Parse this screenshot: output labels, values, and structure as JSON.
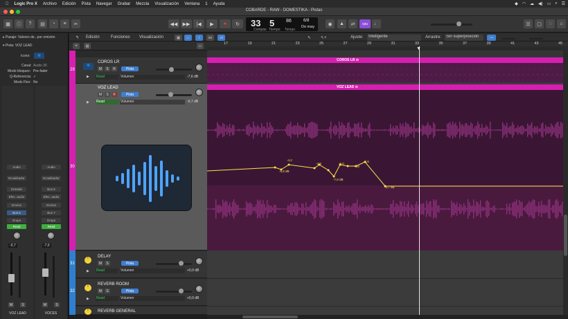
{
  "menubar": {
    "app": "Logic Pro X",
    "items": [
      "Archivo",
      "Edición",
      "Pista",
      "Navegar",
      "Grabar",
      "Mezcla",
      "Visualización",
      "Ventana",
      "1",
      "Ayuda"
    ]
  },
  "window": {
    "title": "COBARDE - RAW - DOMESTIKA - Pistas"
  },
  "lcd": {
    "bar": "33",
    "beat": "5",
    "bar_label": "Compás",
    "beat_label": "Tiempo",
    "tempo": "86",
    "tempo_label": "Tempo",
    "signature": "6/8",
    "key": "Do may",
    "badge": "cpu"
  },
  "toolbar": {
    "edicion": "Edición",
    "funciones": "Funciones",
    "visualizacion": "Visualización",
    "ajuste_label": "Ajuste:",
    "ajuste_value": "Inteligente",
    "arrastre_label": "Arrastre:",
    "arrastre_value": "Sin superposición"
  },
  "inspector": {
    "region_label": "Pasaje:",
    "region_value": "Valores de...por omisión",
    "track_label": "Pista:",
    "track_value": "VOZ LEAD",
    "icono_label": "Icono:",
    "canal_label": "Canal:",
    "canal_value": "Audio 36",
    "modo_bloqueo_label": "Modo bloqueo:",
    "modo_bloqueo_value": "Pre-fader",
    "qref_label": "Q-Referencia:",
    "qref_value": "✓",
    "modo_flex_label": "Modo Flex:",
    "modo_flex_value": "No",
    "strip_left": {
      "audio": "Audio",
      "ecualizador": "Ecualizador",
      "entrada": "Entrada",
      "efec_audio": "Efec. audio",
      "envios": "Envíos",
      "send1": "Bus 5",
      "grupo": "Grupo",
      "automation": "Read",
      "db": "-9,7",
      "name": "VOZ LEAD"
    },
    "strip_right": {
      "audio": "Audio",
      "ecualizador": "Ecualizador",
      "entrada": "Bus 5",
      "efec_audio": "Efec. audio",
      "envios": "Envíos",
      "send1": "Bus 7",
      "grupo": "Grupo",
      "automation": "Read",
      "db": "-7,6",
      "name": "VOCES"
    }
  },
  "ruler": {
    "marks": [
      "17",
      "19",
      "21",
      "23",
      "25",
      "27",
      "29",
      "31",
      "33",
      "35",
      "37",
      "39",
      "41",
      "43",
      "45"
    ]
  },
  "tracks": [
    {
      "number": "29",
      "name": "COROS LR",
      "pista": "Pista",
      "read": "Read",
      "param": "Volumen",
      "db": "-7,6 dB",
      "color": "#d61fb0"
    },
    {
      "number": "30",
      "name": "VOZ LEAD",
      "pista": "Pista",
      "read": "Read",
      "param": "Volumen",
      "db": "-9,7 dB",
      "color": "#d61fb0"
    },
    {
      "number": "31",
      "name": "DELAY",
      "pista": "Pista",
      "read": "Read",
      "param": "Volumen",
      "db": "+0,0 dB",
      "color": "#2f7fd0"
    },
    {
      "number": "32",
      "name": "REVERB ROOM",
      "pista": "Pista",
      "read": "Read",
      "param": "Volumen",
      "db": "+0,0 dB",
      "color": "#2f7fd0"
    },
    {
      "number": "33",
      "name": "REVERB GENERAL",
      "pista": "",
      "read": "",
      "param": "",
      "db": "",
      "color": "#2f7fd0"
    }
  ],
  "regions": {
    "coros": "COROS LR",
    "voz": "VOZ LEAD"
  },
  "automation_points": [
    "-4,2",
    "-5,8 dB",
    "-4,9",
    "-7,6 dB",
    "-5,0",
    "-4,9",
    "-4,6",
    "-9,7 dB"
  ],
  "colors": {
    "region": "#d61fb0",
    "selected_track": "#5a5a5a",
    "pista_button": "#3e7fd0",
    "read_green": "#2fd15a",
    "automation_line": "#ffe24a"
  }
}
